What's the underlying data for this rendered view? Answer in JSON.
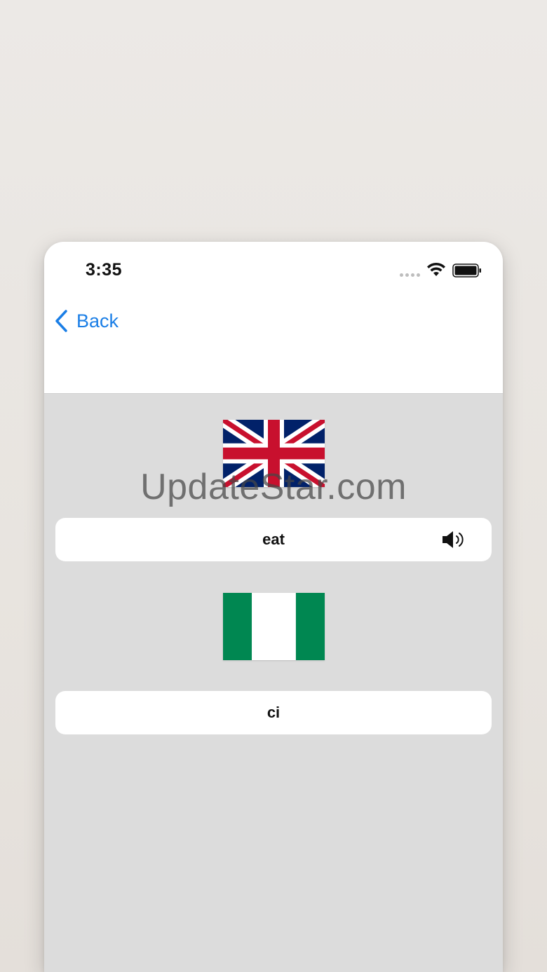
{
  "status_bar": {
    "time": "3:35"
  },
  "nav": {
    "back_label": "Back"
  },
  "source": {
    "flag_icon": "uk-flag-icon",
    "word": "eat"
  },
  "target": {
    "flag_icon": "nigeria-flag-icon",
    "word": "ci"
  },
  "watermark": "UpdateStar.com",
  "colors": {
    "accent": "#1a7ee6",
    "nigeria_green": "#008751",
    "uk_blue": "#012169",
    "uk_red": "#c8102e"
  }
}
